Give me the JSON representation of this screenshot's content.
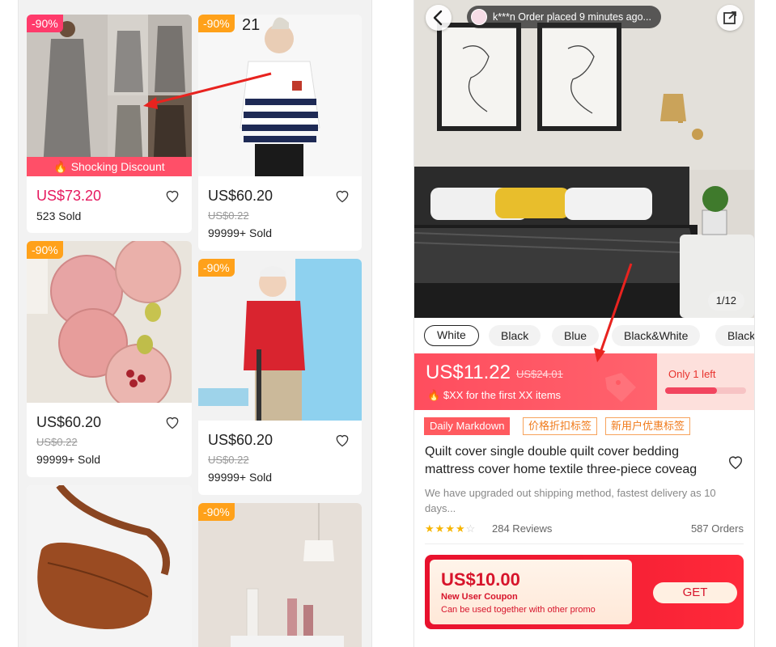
{
  "left_feed": {
    "products": [
      {
        "badge": "-90%",
        "banner": "Shocking Discount",
        "price": "US$73.20",
        "sold": "523 Sold"
      },
      {
        "badge": "-90%",
        "overlay": "21",
        "price": "US$60.20",
        "old_price": "US$0.22",
        "sold": "99999+ Sold"
      },
      {
        "badge": "-90%",
        "price": "US$60.20",
        "old_price": "US$0.22",
        "sold": "99999+ Sold"
      },
      {
        "badge": "-90%",
        "price": "US$60.20",
        "old_price": "US$0.22",
        "sold": "99999+ Sold"
      },
      {},
      {
        "badge": "-90%"
      }
    ]
  },
  "detail": {
    "order_ticker": "k***n Order placed 9 minutes ago...",
    "image_counter": "1/12",
    "colors": [
      "White",
      "Black",
      "Blue",
      "Black&White",
      "Black"
    ],
    "selected_color": "White",
    "price": "US$11.22",
    "original_price": "US$24.01",
    "promo_line": "$XX for the first XX items",
    "stock_label": "Only 1 left",
    "stock_fraction": 0.64,
    "tags": [
      "Daily Markdown",
      "价格折扣标签",
      "新用户优惠标签"
    ],
    "title": "Quilt cover single double quilt cover bedding mattress cover home textile three-piece coveag",
    "description": "We have upgraded out shipping method, fastest delivery as 10 days...",
    "rating": 3.5,
    "reviews": "284 Reviews",
    "orders": "587 Orders",
    "coupon": {
      "amount": "US$10.00",
      "label": "New User Coupon",
      "note": "Can be used together with other promo",
      "button": "GET"
    }
  },
  "colors": {
    "accent_red": "#ff4d5e",
    "badge_orange": "#ffa11a",
    "price_pink": "#e6195f",
    "annotation_arrow": "#e8231f"
  }
}
